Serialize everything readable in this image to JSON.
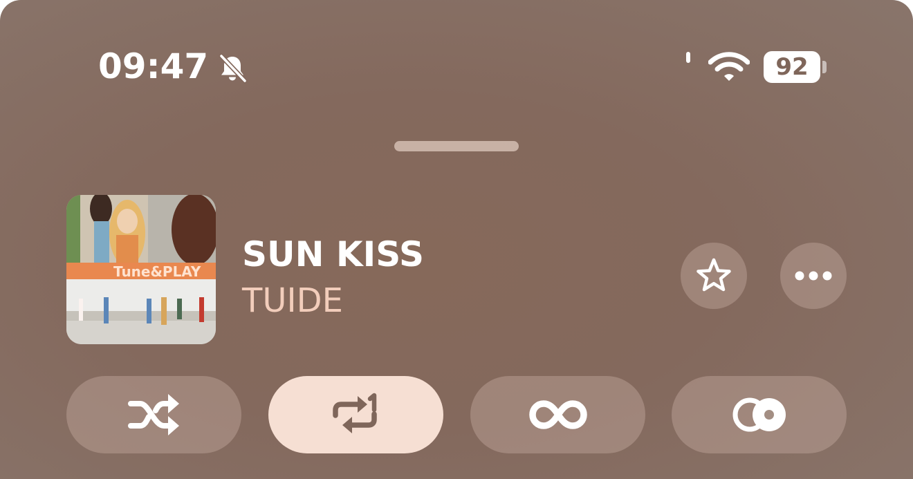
{
  "status_bar": {
    "time": "09:47",
    "silent_icon": "bell-slash-icon",
    "wifi_icon": "wifi-icon",
    "battery_level": "92"
  },
  "now_playing": {
    "title": "SUN KISS",
    "artist": "TUIDE",
    "artwork_text": "Tune&PLAY",
    "favorite_icon": "star-outline-icon",
    "more_icon": "ellipsis-icon"
  },
  "playback_modes": [
    {
      "name": "shuffle",
      "icon": "shuffle-icon",
      "active": false
    },
    {
      "name": "repeat-one",
      "icon": "repeat-one-icon",
      "active": true
    },
    {
      "name": "autoplay",
      "icon": "infinity-icon",
      "active": false
    },
    {
      "name": "crossfade",
      "icon": "crossfade-icon",
      "active": false
    }
  ],
  "colors": {
    "background": "#84695d",
    "artist_text": "#f2cdbb",
    "active_pill": "#f6dfd3",
    "active_icon": "#7f665a",
    "artwork_banner": "#e9884f"
  }
}
